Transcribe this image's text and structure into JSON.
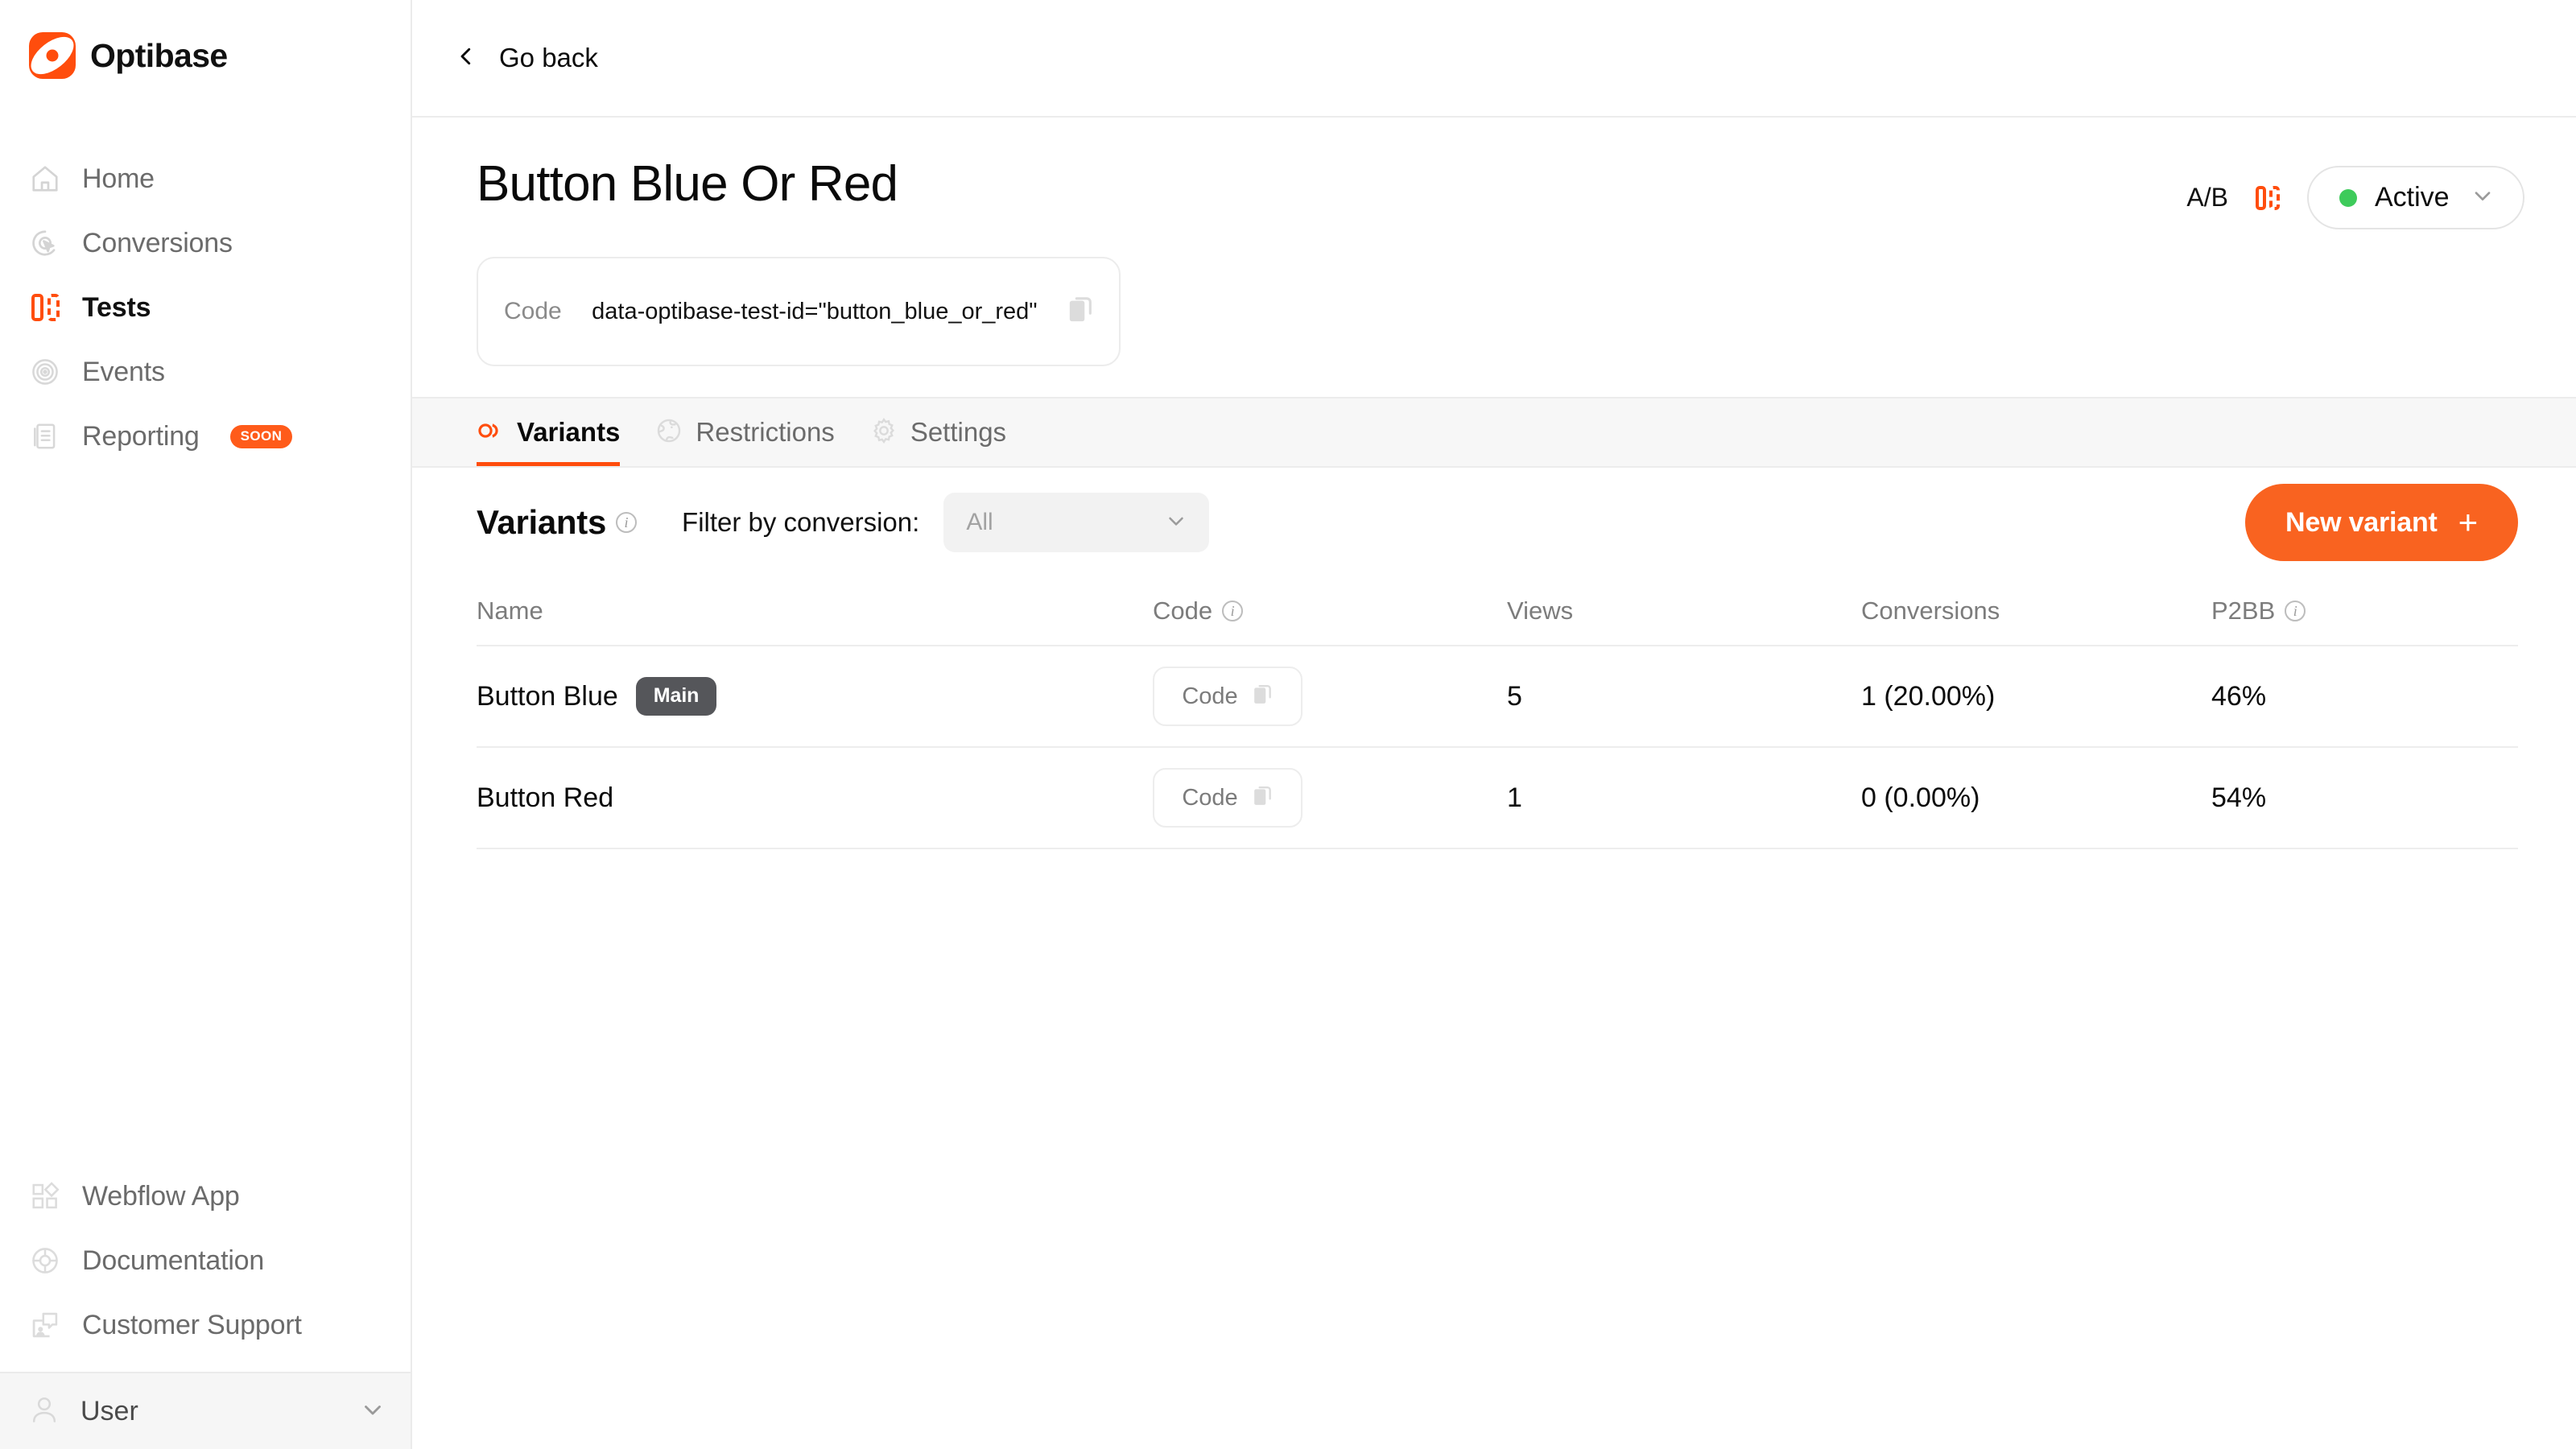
{
  "brand": {
    "name": "Optibase",
    "logo_icon": "optibase-eye-logo",
    "accent": "#FF4D0D"
  },
  "sidebar": {
    "main_items": [
      {
        "label": "Home",
        "icon": "home-icon",
        "active": false
      },
      {
        "label": "Conversions",
        "icon": "cursor-target-icon",
        "active": false
      },
      {
        "label": "Tests",
        "icon": "ab-test-icon",
        "active": true
      },
      {
        "label": "Events",
        "icon": "target-rings-icon",
        "active": false
      },
      {
        "label": "Reporting",
        "icon": "document-report-icon",
        "active": false,
        "badge": "SOON"
      }
    ],
    "bottom_items": [
      {
        "label": "Webflow App",
        "icon": "grid-shapes-icon"
      },
      {
        "label": "Documentation",
        "icon": "lifebuoy-icon"
      },
      {
        "label": "Customer Support",
        "icon": "support-chat-icon"
      }
    ],
    "user": {
      "label": "User",
      "icon": "person-icon",
      "chevron": "chevron-down-icon"
    }
  },
  "topbar": {
    "back_label": "Go back",
    "back_icon": "chevron-left-icon"
  },
  "header": {
    "title": "Button Blue Or Red",
    "ab_label": "A/B",
    "ab_icon": "ab-test-icon",
    "status": {
      "text": "Active",
      "dot_color": "#3ECB5B",
      "chevron": "chevron-down-icon"
    },
    "code": {
      "label": "Code",
      "value": "data-optibase-test-id=\"button_blue_or_red\"",
      "copy_icon": "copy-icon"
    }
  },
  "tabs": [
    {
      "label": "Variants",
      "icon": "variants-icon",
      "active": true
    },
    {
      "label": "Restrictions",
      "icon": "globe-icon",
      "active": false
    },
    {
      "label": "Settings",
      "icon": "gear-icon",
      "active": false
    }
  ],
  "variants_toolbar": {
    "title": "Variants",
    "title_info_icon": "info-icon",
    "filter_label": "Filter by conversion:",
    "filter_value": "All",
    "filter_chevron": "chevron-down-icon",
    "new_variant_label": "New variant",
    "new_variant_icon": "plus-icon",
    "new_variant_color": "#F96320"
  },
  "table": {
    "columns": [
      {
        "label": "Name",
        "info": false
      },
      {
        "label": "Code",
        "info": true
      },
      {
        "label": "Views",
        "info": false
      },
      {
        "label": "Conversions",
        "info": false
      },
      {
        "label": "P2BB",
        "info": true
      }
    ],
    "rows": [
      {
        "name": "Button Blue",
        "badge": "Main",
        "code_label": "Code",
        "code_icon": "copy-icon",
        "views": "5",
        "conversions": "1 (20.00%)",
        "p2bb": "46%"
      },
      {
        "name": "Button Red",
        "badge": "",
        "code_label": "Code",
        "code_icon": "copy-icon",
        "views": "1",
        "conversions": "0 (0.00%)",
        "p2bb": "54%"
      }
    ]
  }
}
